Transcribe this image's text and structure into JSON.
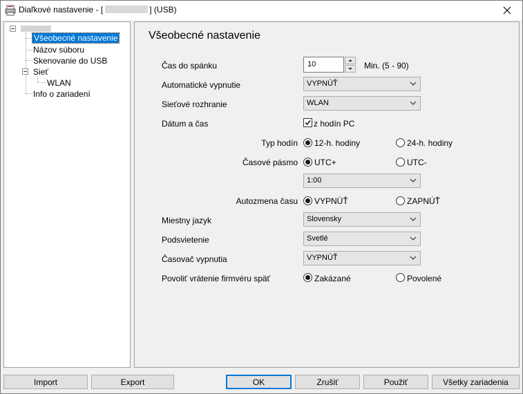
{
  "window": {
    "title_prefix": "Diaľkové nastavenie - [",
    "title_suffix": "] (USB)"
  },
  "tree": {
    "items": [
      {
        "label": "Všeobecné nastavenie"
      },
      {
        "label": "Názov súboru"
      },
      {
        "label": "Skenovanie do USB"
      },
      {
        "label": "Sieť"
      },
      {
        "label": "WLAN"
      },
      {
        "label": "Info o zariadení"
      }
    ]
  },
  "content": {
    "heading": "Všeobecné nastavenie",
    "sleep_time": {
      "label": "Čas do spánku",
      "value": "10",
      "unit": "Min. (5 - 90)"
    },
    "auto_power_off": {
      "label": "Automatické vypnutie",
      "value": "VYPNÚŤ"
    },
    "network_interface": {
      "label": "Sieťové rozhranie",
      "value": "WLAN"
    },
    "date_time": {
      "label": "Dátum a čas",
      "checkbox_label": "z hodín PC",
      "checked": true
    },
    "clock_type": {
      "label": "Typ hodín",
      "option1": "12-h. hodiny",
      "option2": "24-h. hodiny",
      "selected": 1
    },
    "time_zone": {
      "label": "Časové pásmo",
      "option1": "UTC+",
      "option2": "UTC-",
      "selected": 1,
      "offset": "1:00"
    },
    "dst": {
      "label": "Autozmena času",
      "option1": "VYPNÚŤ",
      "option2": "ZAPNÚŤ",
      "selected": 1
    },
    "local_language": {
      "label": "Miestny jazyk",
      "value": "Slovensky"
    },
    "backlight": {
      "label": "Podsvietenie",
      "value": "Svetlé"
    },
    "dim_timer": {
      "label": "Časovač vypnutia",
      "value": "VYPNÚŤ"
    },
    "firmware_rollback": {
      "label": "Povoliť vrátenie firmvéru späť",
      "option1": "Zakázané",
      "option2": "Povolené",
      "selected": 1
    }
  },
  "buttons": {
    "import": "Import",
    "export": "Export",
    "ok": "OK",
    "cancel": "Zrušiť",
    "apply": "Použiť",
    "all_devices": "Všetky zariadenia"
  },
  "colors": {
    "selection": "#0078d7",
    "panel": "#f0f0f0"
  }
}
